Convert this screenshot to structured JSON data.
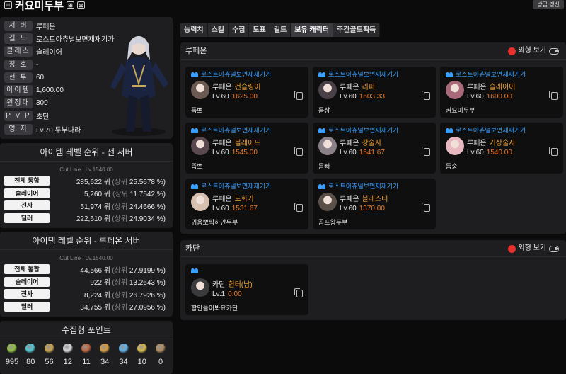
{
  "header": {
    "title": "커요미두부",
    "refresh_label": "방금 갱신"
  },
  "profile": {
    "rows": [
      {
        "label": "서 버",
        "value": "루페온"
      },
      {
        "label": "길 드",
        "value": "로스트아츄널보면재재기가"
      },
      {
        "label": "클래스",
        "value": "슬레이어"
      },
      {
        "label": "칭 호",
        "value": "-"
      },
      {
        "label": "전 투",
        "value": "60"
      },
      {
        "label": "아이템",
        "value": "1,600.00"
      },
      {
        "label": "원정대",
        "value": "300"
      },
      {
        "label": "P V P",
        "value": "초단"
      },
      {
        "label": "영 지",
        "value": "Lv.70 두부나라"
      }
    ]
  },
  "rank_all": {
    "title": "아이템 레벨 순위 - 전 서버",
    "cutline": "Cut Line : Lv.1540.00",
    "rows": [
      {
        "label": "전체 통합",
        "rank": "285,622 위",
        "pct_prefix": "(상위",
        "pct": "25.5678 %)"
      },
      {
        "label": "슬레이어",
        "rank": "5,260 위",
        "pct_prefix": "(상위",
        "pct": "11.7542 %)"
      },
      {
        "label": "전사",
        "rank": "51,974 위",
        "pct_prefix": "(상위",
        "pct": "24.4666 %)"
      },
      {
        "label": "딜러",
        "rank": "222,610 위",
        "pct_prefix": "(상위",
        "pct": "24.9034 %)"
      }
    ]
  },
  "rank_server": {
    "title": "아이템 레벨 순위 - 루페온 서버",
    "cutline": "Cut Line : Lv.1540.00",
    "rows": [
      {
        "label": "전체 통합",
        "rank": "44,566 위",
        "pct_prefix": "(상위",
        "pct": "27.9199 %)"
      },
      {
        "label": "슬레이어",
        "rank": "922 위",
        "pct_prefix": "(상위",
        "pct": "13.2643 %)"
      },
      {
        "label": "전사",
        "rank": "8,224 위",
        "pct_prefix": "(상위",
        "pct": "26.7926 %)"
      },
      {
        "label": "딜러",
        "rank": "34,755 위",
        "pct_prefix": "(상위",
        "pct": "27.0956 %)"
      }
    ]
  },
  "collect": {
    "title": "수집형 포인트",
    "items": [
      {
        "icon": "mokoko-seed-icon",
        "color": "#8fbf3a",
        "count": "995"
      },
      {
        "icon": "island-heart-icon",
        "color": "#4fc7d8",
        "count": "80"
      },
      {
        "icon": "great-art-icon",
        "color": "#c9a24a",
        "count": "56"
      },
      {
        "icon": "giant-heart-icon",
        "color": "#d8d8d8",
        "count": "12"
      },
      {
        "icon": "ignea-token-icon",
        "color": "#c0623a",
        "count": "11"
      },
      {
        "icon": "sea-bounty-icon",
        "color": "#d89a3a",
        "count": "34"
      },
      {
        "icon": "world-tree-leaf-icon",
        "color": "#5ab0e8",
        "count": "34"
      },
      {
        "icon": "orpheus-star-icon",
        "color": "#d8b84a",
        "count": "10"
      },
      {
        "icon": "omnium-star-icon",
        "color": "#b08a5a",
        "count": "0"
      }
    ]
  },
  "tabs": [
    "능력치",
    "스킬",
    "수집",
    "도표",
    "길드",
    "보유 캐릭터",
    "주간골드획득"
  ],
  "active_tab": 5,
  "appearance_label": "외형 보기",
  "servers": [
    {
      "name": "루페온",
      "characters": [
        {
          "guild": "로스트아츄널보면재재기가",
          "server": "루페온",
          "class": "건슬링어",
          "level": "Lv.60",
          "item_level": "1625.00",
          "nickname": "듬뽀",
          "face": "#6b5a52"
        },
        {
          "guild": "로스트아츄널보면재재기가",
          "server": "루페온",
          "class": "리퍼",
          "level": "Lv.60",
          "item_level": "1603.33",
          "nickname": "듬삼",
          "face": "#4a4048"
        },
        {
          "guild": "로스트아츄널보면재재기가",
          "server": "루페온",
          "class": "슬레이어",
          "level": "Lv.60",
          "item_level": "1600.00",
          "nickname": "커요미두부",
          "face": "#a86a7a"
        },
        {
          "guild": "로스트아츄널보면재재기가",
          "server": "루페온",
          "class": "블레이드",
          "level": "Lv.60",
          "item_level": "1545.00",
          "nickname": "뜹뽀",
          "face": "#5a4a50"
        },
        {
          "guild": "로스트아츄널보면재재기가",
          "server": "루페온",
          "class": "창술사",
          "level": "Lv.60",
          "item_level": "1541.67",
          "nickname": "듬빠",
          "face": "#8a8088"
        },
        {
          "guild": "로스트아츄널보면재재기가",
          "server": "루페온",
          "class": "기상술사",
          "level": "Lv.60",
          "item_level": "1540.00",
          "nickname": "듬숭",
          "face": "#e8b8c0"
        },
        {
          "guild": "로스트아츄널보면재재기가",
          "server": "루페온",
          "class": "도화가",
          "level": "Lv.60",
          "item_level": "1531.67",
          "nickname": "귀욤뽀짝하얀두부",
          "face": "#d8c0b0"
        },
        {
          "guild": "로스트아츄널보면재재기가",
          "server": "루페온",
          "class": "블레스터",
          "level": "Lv.60",
          "item_level": "1370.00",
          "nickname": "곰프왕두부",
          "face": "#5a5048"
        }
      ]
    },
    {
      "name": "카단",
      "characters": [
        {
          "guild": "-",
          "server": "카단",
          "class": "헌터(남)",
          "level": "Lv.1",
          "item_level": "0.00",
          "nickname": "함안들어봐요카단",
          "face": "#3a3a3c"
        }
      ]
    }
  ]
}
